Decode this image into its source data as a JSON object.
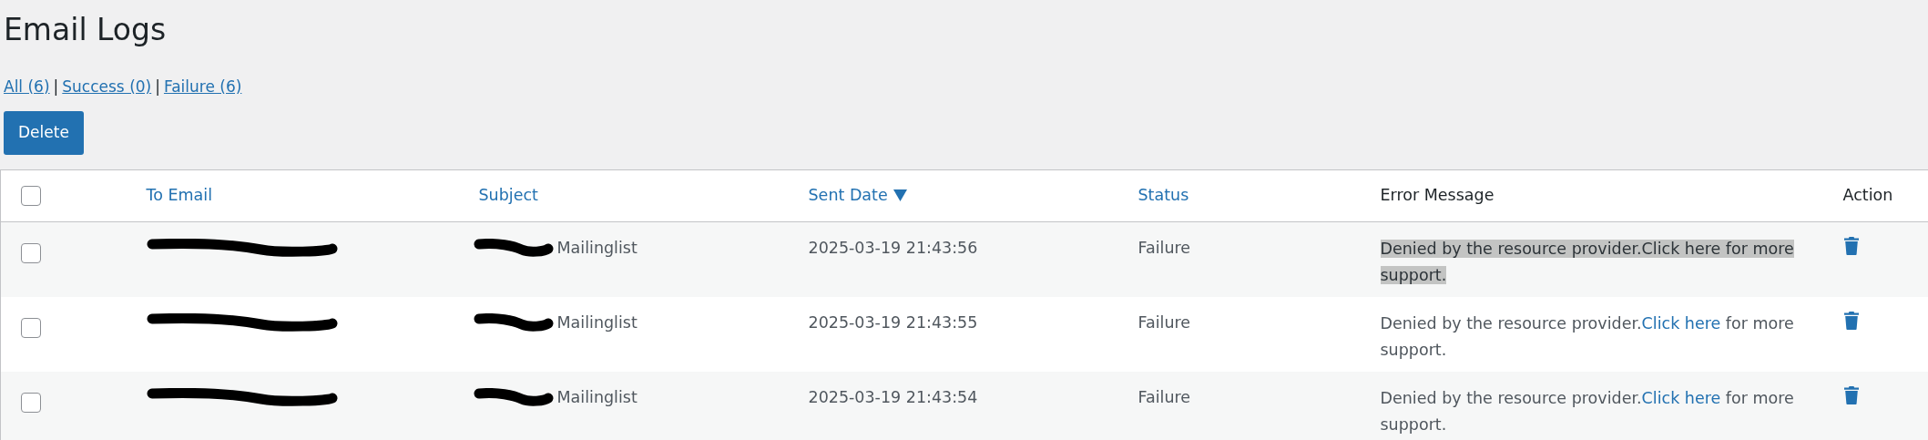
{
  "page": {
    "title": "Email Logs"
  },
  "filters": [
    {
      "kind": "link",
      "label": "All (6)"
    },
    {
      "kind": "separator",
      "label": "|"
    },
    {
      "kind": "link",
      "label": "Success (0)"
    },
    {
      "kind": "separator",
      "label": "|"
    },
    {
      "kind": "link",
      "label": "Failure (6)"
    }
  ],
  "bulk_button": {
    "label": "Delete"
  },
  "table": {
    "select_all": {
      "checked": false
    },
    "columns": [
      {
        "label": "To Email",
        "sortable": true,
        "sorted": false
      },
      {
        "label": "Subject",
        "sortable": true,
        "sorted": false
      },
      {
        "label": "Sent Date",
        "sortable": true,
        "sorted": true
      },
      {
        "label": "Status",
        "sortable": true,
        "sorted": false
      },
      {
        "label": "Error Message",
        "sortable": false
      },
      {
        "label": "Action",
        "sortable": false
      }
    ],
    "rows": [
      {
        "checked": false,
        "email": {
          "redacted": true
        },
        "subject": {
          "redacted": true,
          "text": "Mailinglist"
        },
        "sent_date": "2025-03-19 21:43:56",
        "status": "Failure",
        "error": {
          "text": "Denied by the resource provider.",
          "link": "Click here",
          "after": " for more support.",
          "highlighted": true
        }
      },
      {
        "checked": false,
        "email": {
          "redacted": true
        },
        "subject": {
          "redacted": true,
          "text": "Mailinglist"
        },
        "sent_date": "2025-03-19 21:43:55",
        "status": "Failure",
        "error": {
          "text": "Denied by the resource provider.",
          "link": "Click here",
          "after": " for more support.",
          "highlighted": false
        }
      },
      {
        "checked": false,
        "email": {
          "redacted": true
        },
        "subject": {
          "redacted": true,
          "text": "Mailinglist"
        },
        "sent_date": "2025-03-19 21:43:54",
        "status": "Failure",
        "error": {
          "text": "Denied by the resource provider.",
          "link": "Click here",
          "after": " for more support.",
          "highlighted": false
        }
      }
    ]
  }
}
